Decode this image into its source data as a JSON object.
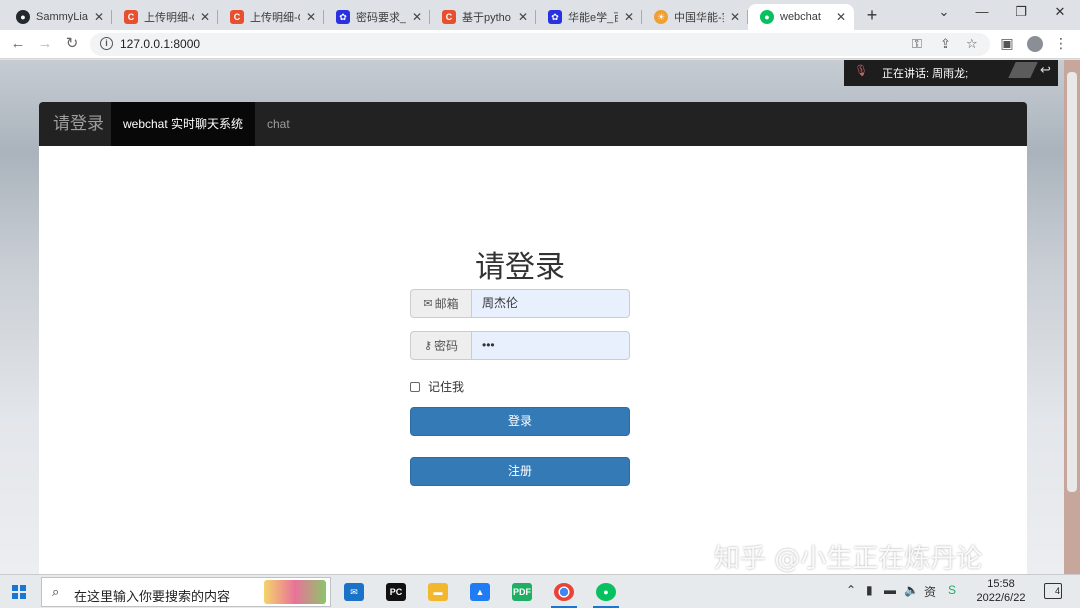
{
  "browser": {
    "tabs": [
      {
        "title": "SammyLia",
        "favicon": "github-icon",
        "color": "#24292e"
      },
      {
        "title": "上传明细-C",
        "favicon": "csdn-icon",
        "color": "#e84f2f"
      },
      {
        "title": "上传明细-C",
        "favicon": "csdn-icon",
        "color": "#e84f2f"
      },
      {
        "title": "密码要求_百",
        "favicon": "baidu-icon",
        "color": "#2932e1"
      },
      {
        "title": "基于pytho",
        "favicon": "csdn-icon",
        "color": "#e84f2f"
      },
      {
        "title": "华能e学_百",
        "favicon": "baidu-icon",
        "color": "#2932e1"
      },
      {
        "title": "中国华能-实",
        "favicon": "huaneng-icon",
        "color": "#f0a030"
      },
      {
        "title": "webchat",
        "favicon": "wechat-icon",
        "color": "#07c160"
      }
    ],
    "active_tab_index": 7,
    "url": "127.0.0.1:8000"
  },
  "page": {
    "navbar": {
      "brand": "请登录",
      "active_item": "webchat 实时聊天系统",
      "chat_item": "chat"
    },
    "login": {
      "title": "请登录",
      "email_label": "邮箱",
      "email_value": "周杰伦",
      "password_label": "密码",
      "password_value": "•••",
      "remember_label": "记住我",
      "login_button": "登录",
      "register_button": "注册"
    },
    "speaking": {
      "text": "正在讲话: 周雨龙;"
    },
    "watermark": "知乎 @小生正在炼丹论"
  },
  "taskbar": {
    "search_placeholder": "在这里输入你要搜索的内容",
    "time": "15:58",
    "date": "2022/6/22",
    "ime_label": "资",
    "notification_count": "4",
    "apps": [
      "mail-icon",
      "pycharm-icon",
      "file-explorer-icon",
      "tencent-meeting-icon",
      "pdf-icon",
      "chrome-icon",
      "wechat-icon"
    ]
  }
}
